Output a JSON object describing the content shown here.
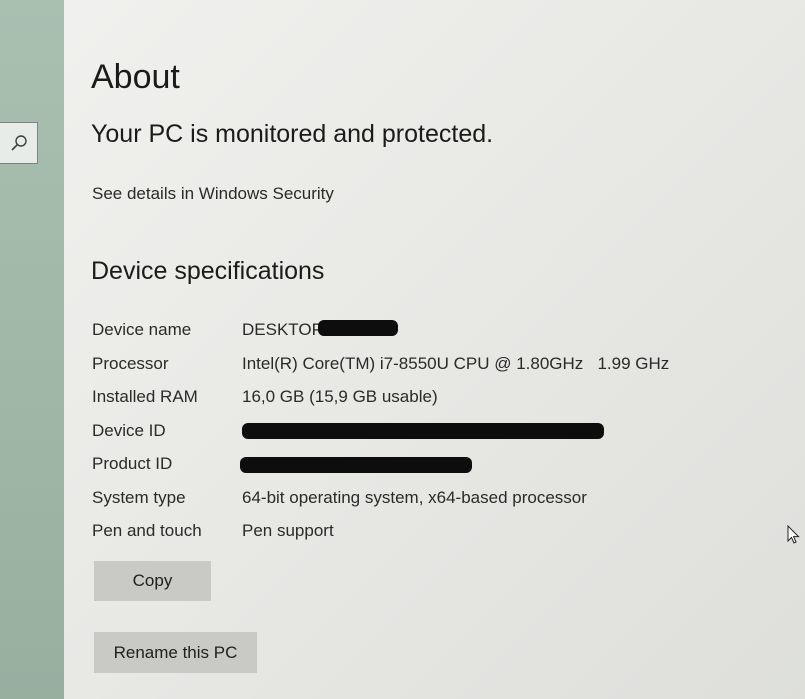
{
  "about": {
    "title": "About",
    "protection_status": "Your PC is monitored and protected.",
    "security_link": "See details in Windows Security"
  },
  "specs": {
    "heading": "Device specifications",
    "rows": [
      {
        "label": "Device name",
        "value": "DESKTOP"
      },
      {
        "label": "Processor",
        "value": "Intel(R) Core(TM) i7-8550U CPU @ 1.80GHz   1.99 GHz"
      },
      {
        "label": "Installed RAM",
        "value": "16,0 GB (15,9 GB usable)"
      },
      {
        "label": "Device ID",
        "value": ""
      },
      {
        "label": "Product ID",
        "value": ""
      },
      {
        "label": "System type",
        "value": "64-bit operating system, x64-based processor"
      },
      {
        "label": "Pen and touch",
        "value": "Pen support"
      }
    ]
  },
  "buttons": {
    "copy": "Copy",
    "rename": "Rename this PC"
  },
  "icons": {
    "search": "search-icon",
    "cursor": "mouse-pointer-icon"
  }
}
